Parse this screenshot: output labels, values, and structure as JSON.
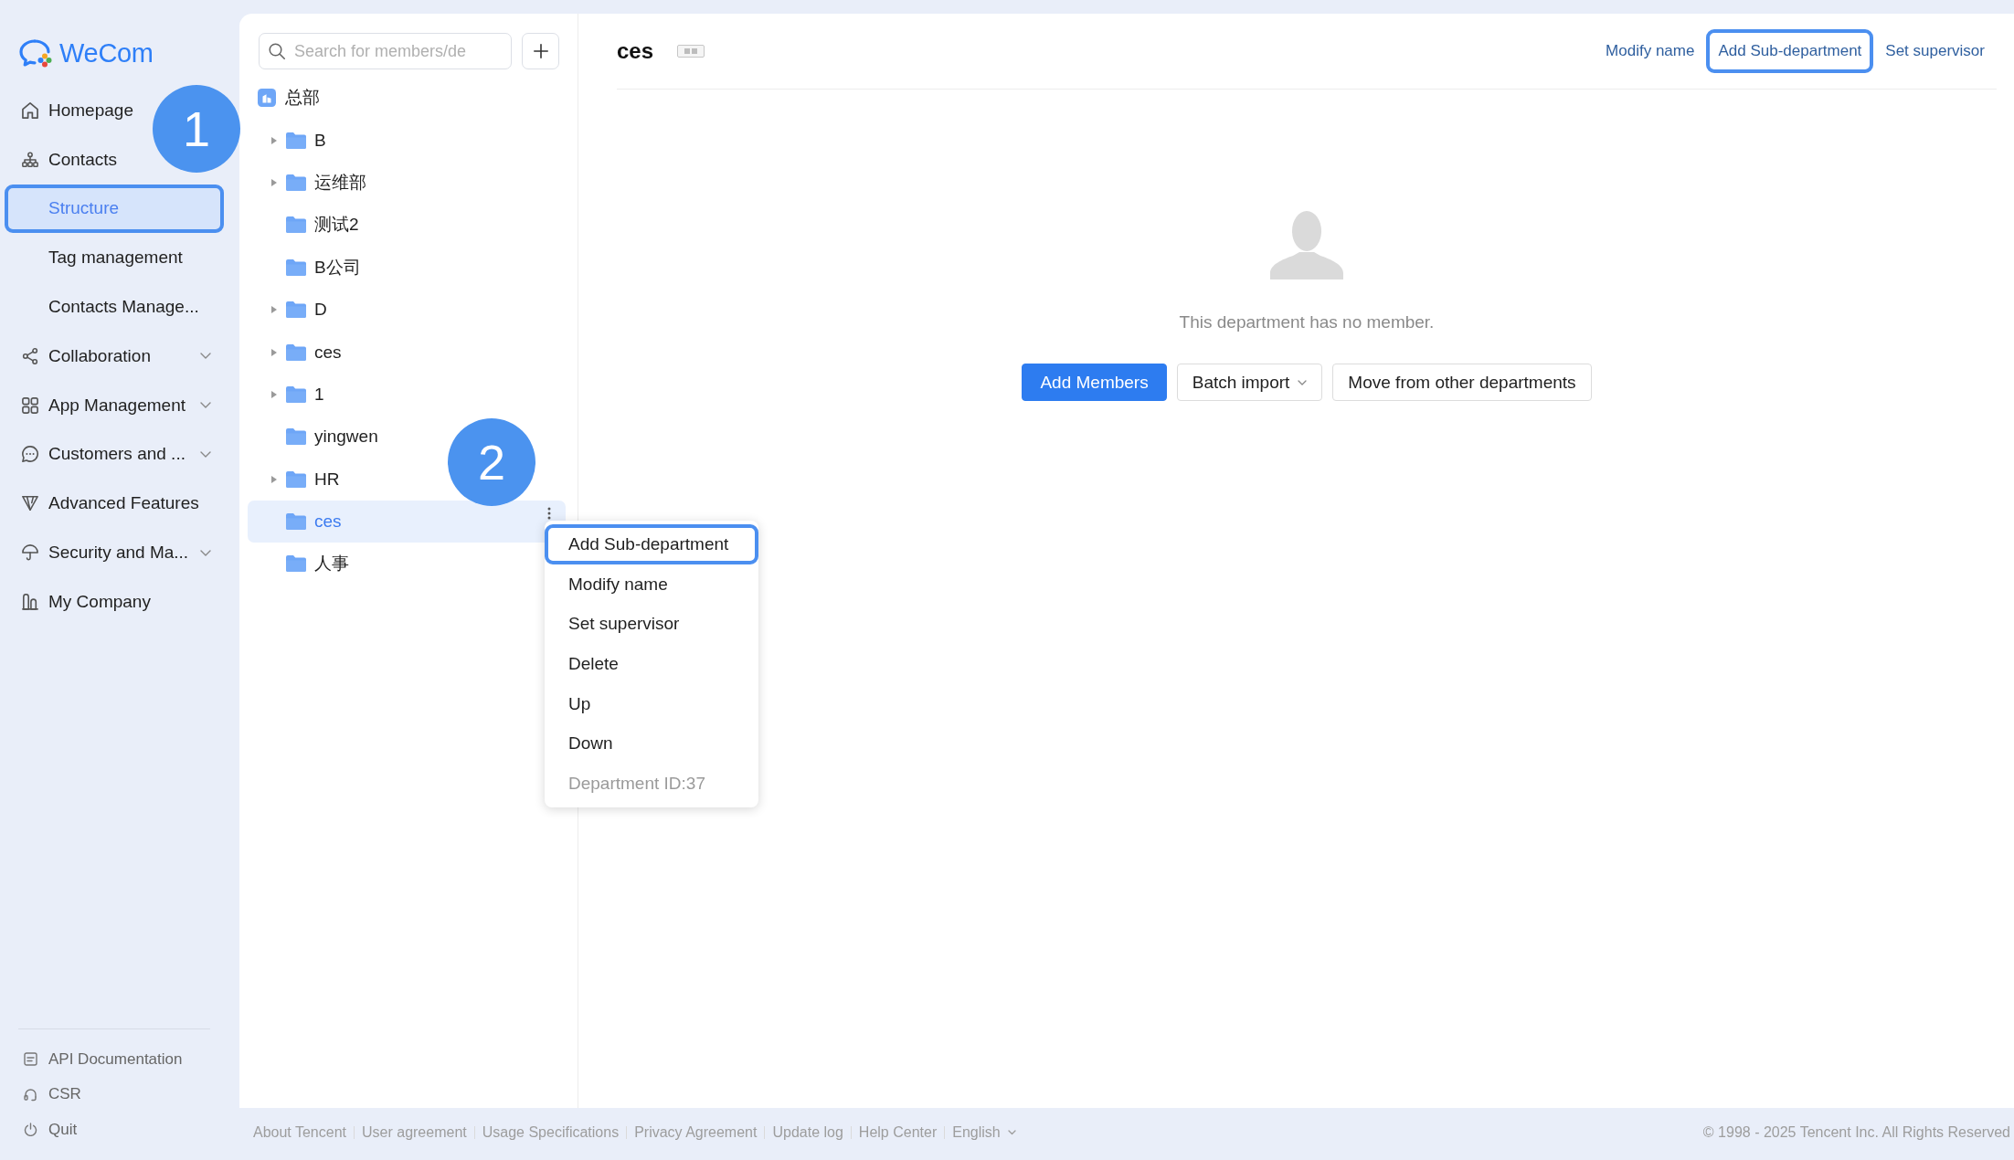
{
  "brand": {
    "name": "WeCom"
  },
  "sidebar": {
    "items": [
      {
        "label": "Homepage",
        "kind": "link",
        "selected": false
      },
      {
        "label": "Contacts",
        "kind": "section",
        "selected": false,
        "children": [
          {
            "label": "Structure",
            "selected": true,
            "highlighted": true
          },
          {
            "label": "Tag management",
            "selected": false,
            "highlighted": false
          },
          {
            "label": "Contacts Manage...",
            "selected": false,
            "highlighted": false
          }
        ]
      },
      {
        "label": "Collaboration",
        "kind": "dropdown",
        "selected": false,
        "expanded": false
      },
      {
        "label": "App Management",
        "kind": "dropdown",
        "selected": false,
        "expanded": false
      },
      {
        "label": "Customers and ...",
        "kind": "dropdown",
        "selected": false,
        "expanded": false
      },
      {
        "label": "Advanced Features",
        "kind": "link",
        "selected": false
      },
      {
        "label": "Security and Ma...",
        "kind": "dropdown",
        "selected": false,
        "expanded": false
      },
      {
        "label": "My Company",
        "kind": "link",
        "selected": false
      }
    ],
    "bottom_links": [
      {
        "label": "API Documentation"
      },
      {
        "label": "CSR"
      },
      {
        "label": "Quit"
      }
    ]
  },
  "tree": {
    "search": {
      "placeholder": "Search for members/de"
    },
    "root": {
      "label": "总部",
      "selected": false,
      "children": [
        {
          "label": "B",
          "kind": "branch",
          "expanded": false,
          "selected": false
        },
        {
          "label": "运维部",
          "kind": "branch",
          "expanded": false,
          "selected": false
        },
        {
          "label": "测试2",
          "kind": "leaf",
          "selected": false
        },
        {
          "label": "B公司",
          "kind": "leaf",
          "selected": false
        },
        {
          "label": "D",
          "kind": "branch",
          "expanded": false,
          "selected": false
        },
        {
          "label": "ces",
          "kind": "branch",
          "expanded": false,
          "selected": false
        },
        {
          "label": "1",
          "kind": "branch",
          "expanded": false,
          "selected": false
        },
        {
          "label": "yingwen",
          "kind": "leaf",
          "selected": false
        },
        {
          "label": "HR",
          "kind": "branch",
          "expanded": false,
          "selected": false
        },
        {
          "label": "ces",
          "kind": "leaf",
          "selected": true
        },
        {
          "label": "人事",
          "kind": "leaf",
          "selected": false
        }
      ]
    }
  },
  "context_menu": {
    "items": [
      {
        "label": "Add Sub-department",
        "kind": "action",
        "highlighted": true
      },
      {
        "label": "Modify name",
        "kind": "action",
        "highlighted": false
      },
      {
        "label": "Set supervisor",
        "kind": "action",
        "highlighted": false
      },
      {
        "label": "Delete",
        "kind": "action",
        "highlighted": false
      },
      {
        "label": "Up",
        "kind": "action",
        "highlighted": false
      },
      {
        "label": "Down",
        "kind": "action",
        "highlighted": false
      },
      {
        "label": "Department ID:37",
        "kind": "info",
        "highlighted": false
      }
    ]
  },
  "header": {
    "title": "ces",
    "actions": [
      {
        "label": "Modify name",
        "highlighted": false
      },
      {
        "label": "Add Sub-department",
        "highlighted": true
      },
      {
        "label": "Set supervisor",
        "highlighted": false
      }
    ]
  },
  "empty_state": {
    "message": "This department has no member.",
    "buttons": [
      {
        "label": "Add Members",
        "kind": "primary"
      },
      {
        "label": "Batch import",
        "kind": "dropdown"
      },
      {
        "label": "Move from other departments",
        "kind": "default"
      }
    ]
  },
  "footer": {
    "links": [
      "About Tencent",
      "User agreement",
      "Usage Specifications",
      "Privacy Agreement",
      "Update log",
      "Help Center"
    ],
    "language": "English",
    "copyright": "© 1998 - 2025 Tencent Inc. All Rights Reserved"
  },
  "annotations": [
    {
      "label": "1"
    },
    {
      "label": "2"
    }
  ]
}
